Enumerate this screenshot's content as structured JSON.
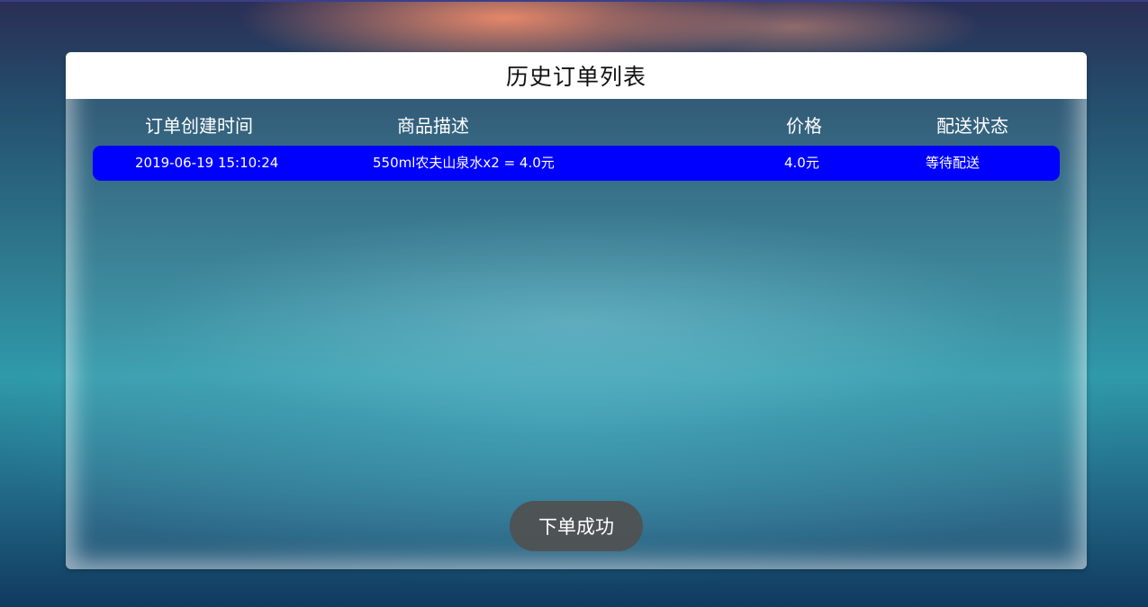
{
  "panel": {
    "title": "历史订单列表"
  },
  "table": {
    "columns": [
      "订单创建时间",
      "商品描述",
      "价格",
      "配送状态"
    ],
    "rows": [
      {
        "created_at": "2019-06-19 15:10:24",
        "description": "550ml农夫山泉水x2 = 4.0元",
        "price": "4.0元",
        "status": "等待配送"
      }
    ]
  },
  "toast": {
    "message": "下单成功"
  },
  "colors": {
    "row_highlight": "#0000ff",
    "header_bg": "#ffffff",
    "toast_bg": "#505050"
  }
}
